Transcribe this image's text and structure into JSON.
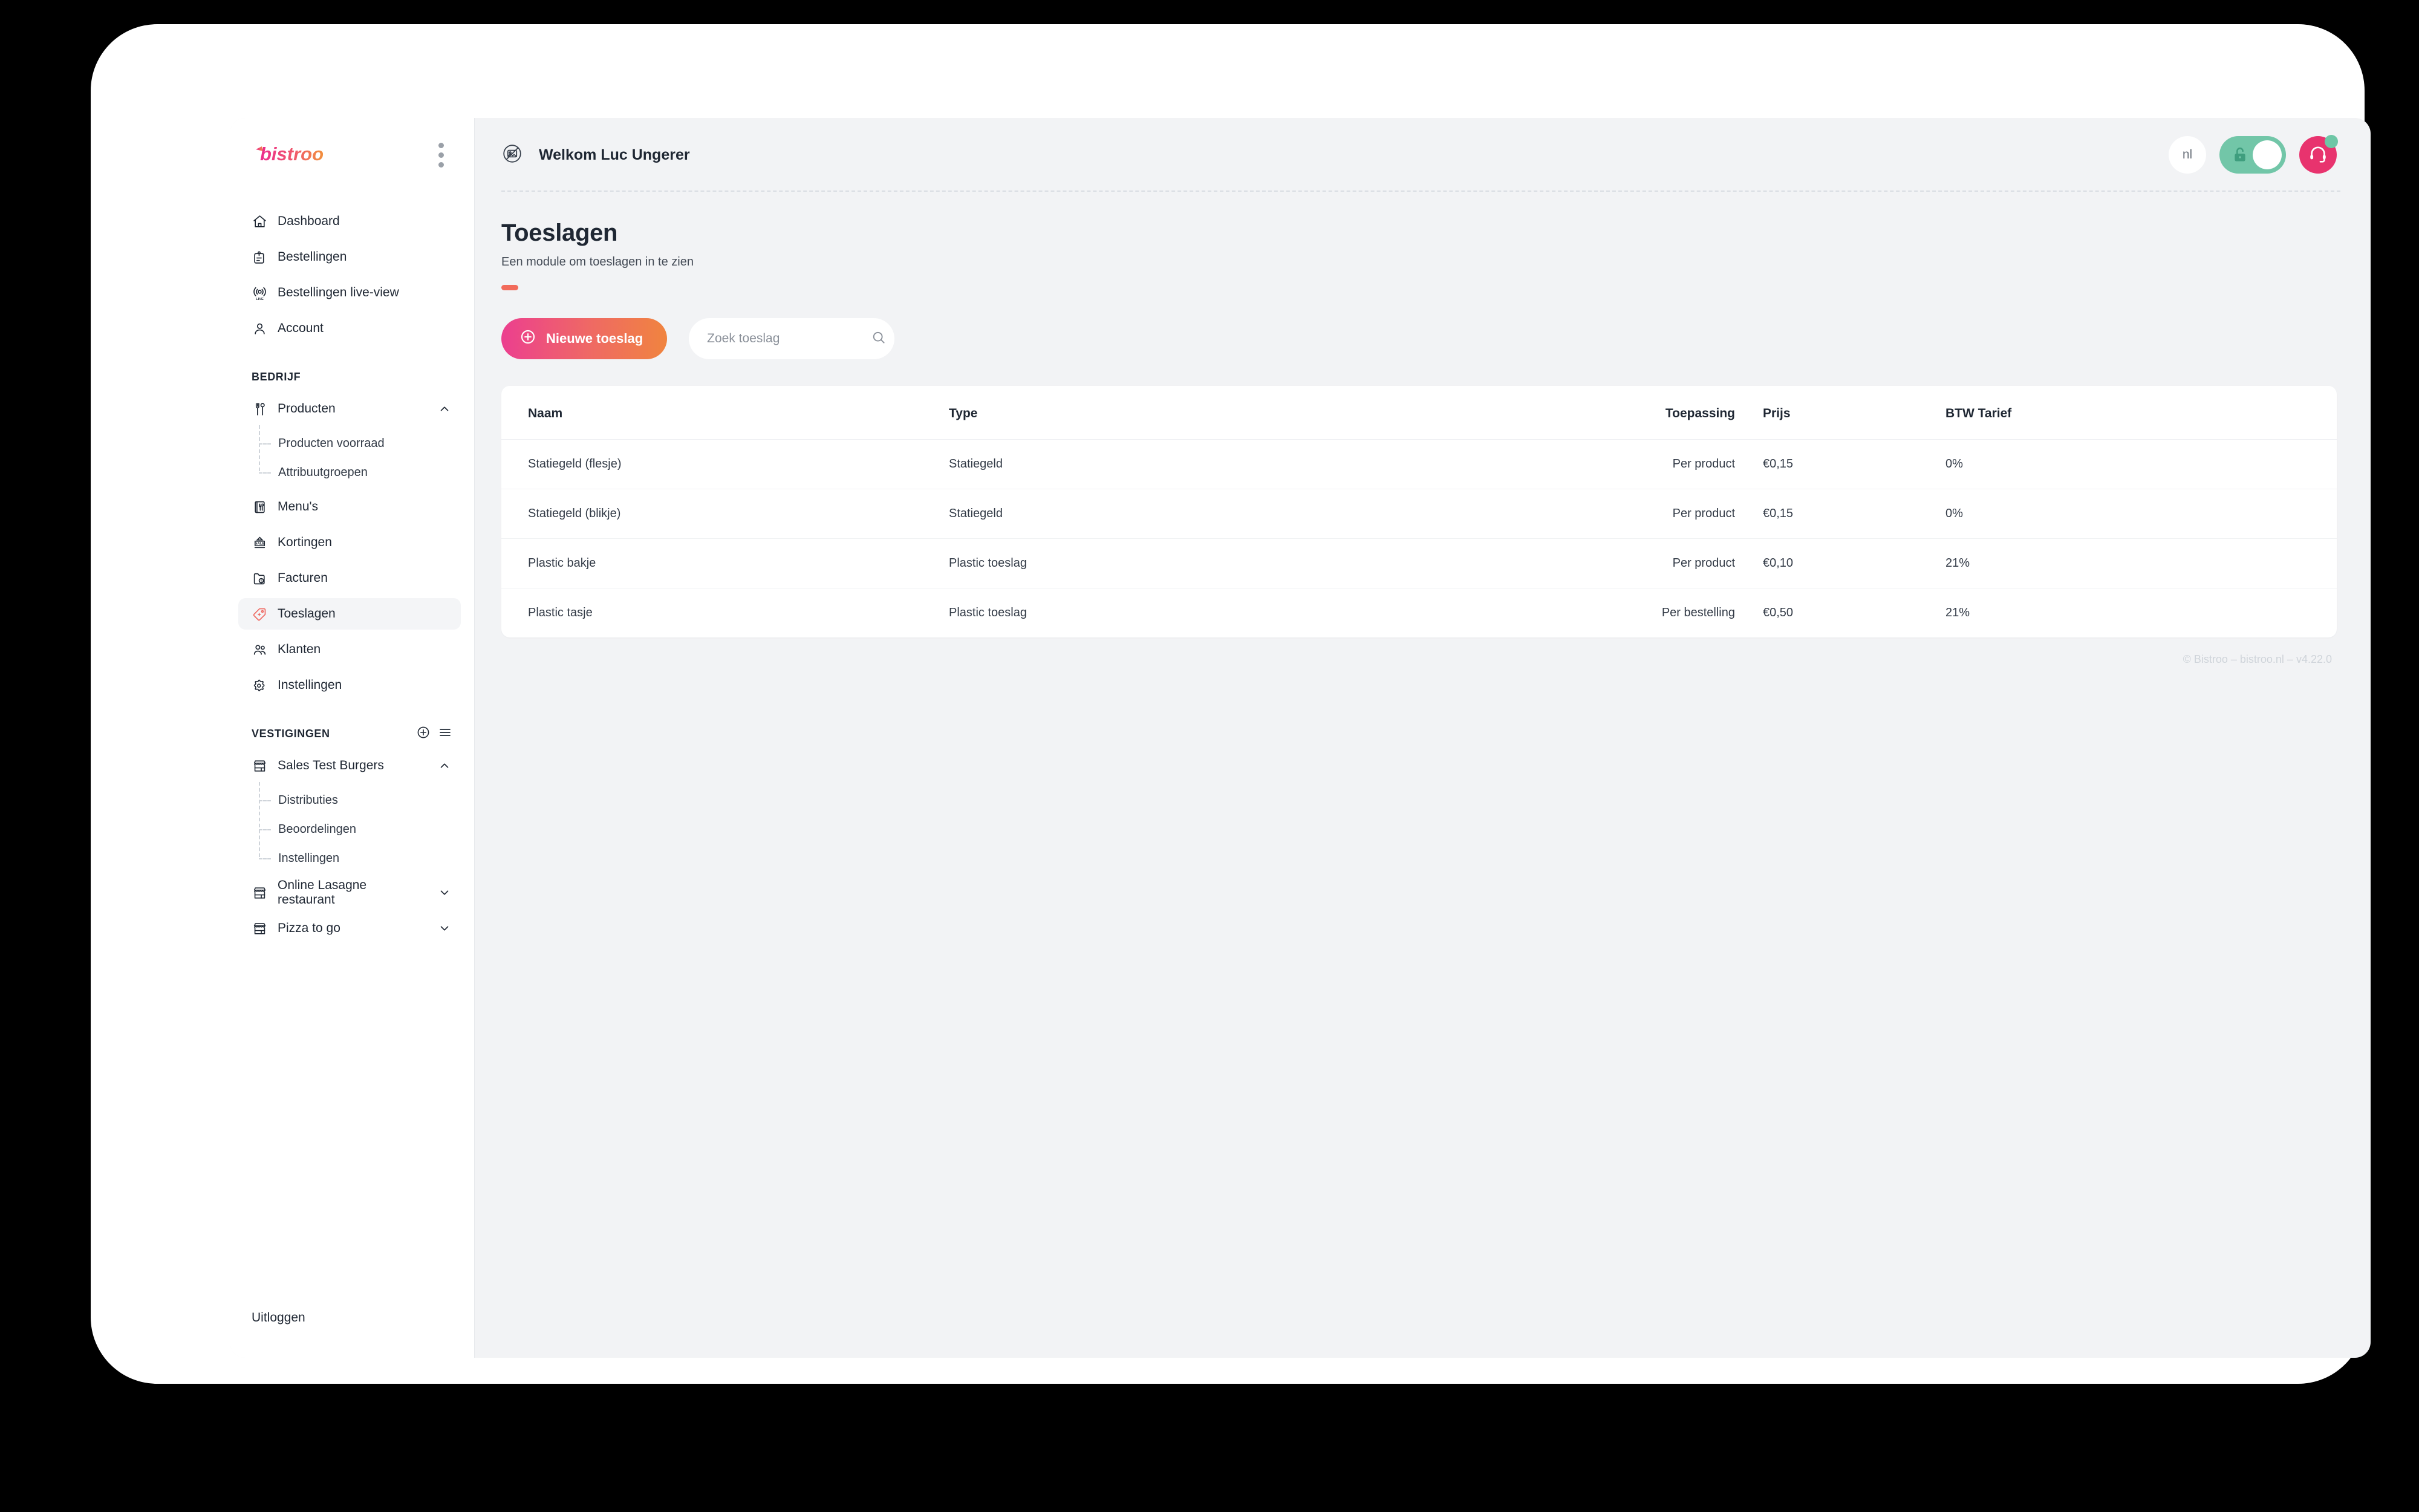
{
  "brand": {
    "name": "bistroo",
    "menu_icon": "kebab-menu-icon"
  },
  "sidebar": {
    "primary_items": [
      {
        "label": "Dashboard",
        "icon": "home-icon"
      },
      {
        "label": "Bestellingen",
        "icon": "orders-icon"
      },
      {
        "label": "Bestellingen live-view",
        "icon": "live-view-icon"
      },
      {
        "label": "Account",
        "icon": "user-icon"
      }
    ],
    "bedrijf_section": {
      "title": "BEDRIJF"
    },
    "bedrijf_items": [
      {
        "label": "Producten",
        "icon": "cutlery-icon",
        "expanded": true,
        "chevron": "chevron-up-icon",
        "children": [
          {
            "label": "Producten voorraad"
          },
          {
            "label": "Attribuutgroepen"
          }
        ]
      },
      {
        "label": "Menu's",
        "icon": "menu-book-icon"
      },
      {
        "label": "Kortingen",
        "icon": "sale-tag-icon"
      },
      {
        "label": "Facturen",
        "icon": "invoice-folder-icon"
      },
      {
        "label": "Toeslagen",
        "icon": "price-tag-icon",
        "active": true
      },
      {
        "label": "Klanten",
        "icon": "customers-icon"
      },
      {
        "label": "Instellingen",
        "icon": "settings-gear-icon"
      }
    ],
    "vestigingen_section": {
      "title": "VESTIGINGEN",
      "add_icon": "plus-circle-icon",
      "list_icon": "hamburger-list-icon"
    },
    "vestigingen_items": [
      {
        "label": "Sales Test Burgers",
        "icon": "storefront-icon",
        "expanded": true,
        "chevron": "chevron-up-icon",
        "children": [
          {
            "label": "Distributies"
          },
          {
            "label": "Beoordelingen"
          },
          {
            "label": "Instellingen"
          }
        ]
      },
      {
        "label": "Online Lasagne restaurant",
        "icon": "storefront-icon",
        "expanded": false,
        "chevron": "chevron-down-icon"
      },
      {
        "label": "Pizza to go",
        "icon": "storefront-icon",
        "expanded": false,
        "chevron": "chevron-down-icon"
      }
    ],
    "logout_label": "Uitloggen"
  },
  "topbar": {
    "avatar_icon": "no-image-avatar-icon",
    "welcome": "Welkom Luc Ungerer",
    "language": "nl",
    "lock_toggle": {
      "icon": "unlock-icon",
      "state": "on"
    },
    "support": {
      "icon": "headset-icon",
      "badge": "online-dot"
    }
  },
  "page": {
    "title": "Toeslagen",
    "subtitle": "Een module om toeslagen in te zien",
    "accent_color": "#f26b5b"
  },
  "toolbar": {
    "new_button_label": "Nieuwe toeslag",
    "new_button_icon": "plus-circle-icon",
    "search_placeholder": "Zoek toeslag",
    "search_value": "",
    "search_icon": "search-icon"
  },
  "table": {
    "columns": [
      "Naam",
      "Type",
      "Toepassing",
      "Prijs",
      "BTW Tarief"
    ],
    "rows": [
      {
        "naam": "Statiegeld (flesje)",
        "type": "Statiegeld",
        "toepassing": "Per product",
        "prijs": "€0,15",
        "btw": "0%"
      },
      {
        "naam": "Statiegeld (blikje)",
        "type": "Statiegeld",
        "toepassing": "Per product",
        "prijs": "€0,15",
        "btw": "0%"
      },
      {
        "naam": "Plastic bakje",
        "type": "Plastic toeslag",
        "toepassing": "Per product",
        "prijs": "€0,10",
        "btw": "21%"
      },
      {
        "naam": "Plastic tasje",
        "type": "Plastic toeslag",
        "toepassing": "Per bestelling",
        "prijs": "€0,50",
        "btw": "21%"
      }
    ]
  },
  "footer": {
    "text": "© Bistroo – bistroo.nl – v4.22.0"
  },
  "colors": {
    "brand_pink": "#ec3f8f",
    "brand_orange": "#f0843f",
    "accent_red": "#f26b5b",
    "toggle_green": "#72c6a8",
    "support_pink": "#e8336e"
  }
}
